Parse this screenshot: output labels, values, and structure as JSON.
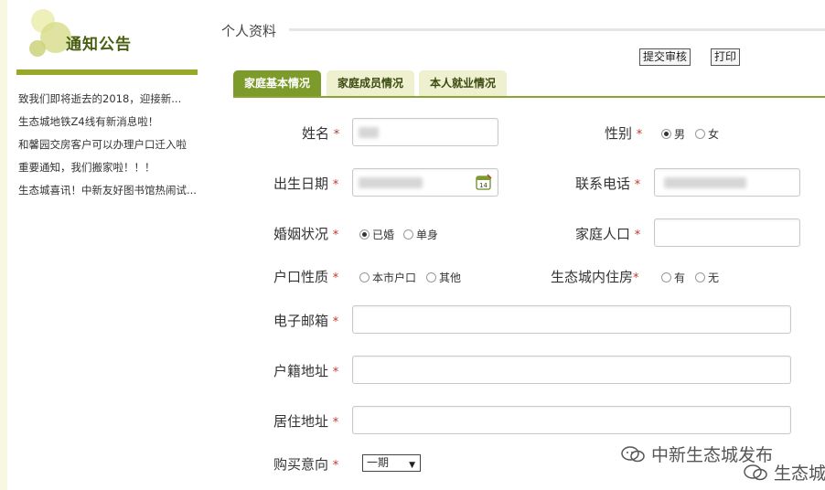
{
  "sidebar": {
    "title": "通知公告",
    "news": [
      "致我们即将逝去的2018，迎接新...",
      "生态城地铁Z4线有新消息啦！",
      "和馨园交房客户可以办理户口迁入啦",
      "重要通知，我们搬家啦！！！",
      "生态城喜讯！中新友好图书馆热闹试..."
    ]
  },
  "header": {
    "title": "个人资料",
    "submit_label": "提交审核",
    "print_label": "打印"
  },
  "tabs": [
    {
      "label": "家庭基本情况",
      "active": true
    },
    {
      "label": "家庭成员情况",
      "active": false
    },
    {
      "label": "本人就业情况",
      "active": false
    }
  ],
  "form": {
    "required_mark": "*",
    "name": {
      "label": "姓名"
    },
    "gender": {
      "label": "性别",
      "options": [
        "男",
        "女"
      ],
      "selected": "男"
    },
    "birth": {
      "label": "出生日期",
      "calendar_day": "14"
    },
    "phone": {
      "label": "联系电话"
    },
    "marital": {
      "label": "婚姻状况",
      "options": [
        "已婚",
        "单身"
      ],
      "selected": "已婚"
    },
    "household": {
      "label": "家庭人口"
    },
    "hukou_type": {
      "label": "户口性质",
      "options": [
        "本市户口",
        "其他"
      ],
      "selected": ""
    },
    "eco_housing": {
      "label": "生态城内住房",
      "options": [
        "有",
        "无"
      ],
      "selected": ""
    },
    "email": {
      "label": "电子邮箱"
    },
    "hukou_address": {
      "label": "户籍地址"
    },
    "residence": {
      "label": "居住地址"
    },
    "purchase": {
      "label": "购买意向",
      "value": "一期"
    }
  },
  "watermark": {
    "line1": "中新生态城发布",
    "line2": "生态城"
  },
  "colors": {
    "accent": "#7c9b2a",
    "tab_inactive": "#eef0cf",
    "required": "#c0392b"
  }
}
